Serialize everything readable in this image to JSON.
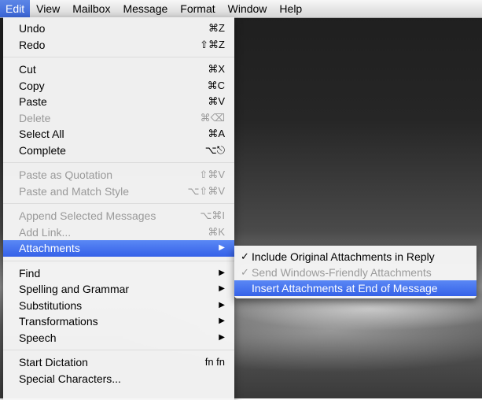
{
  "menubar": {
    "items": [
      "Edit",
      "View",
      "Mailbox",
      "Message",
      "Format",
      "Window",
      "Help"
    ]
  },
  "edit_menu": {
    "undo": {
      "label": "Undo",
      "shortcut": "⌘Z"
    },
    "redo": {
      "label": "Redo",
      "shortcut": "⇧⌘Z"
    },
    "cut": {
      "label": "Cut",
      "shortcut": "⌘X"
    },
    "copy": {
      "label": "Copy",
      "shortcut": "⌘C"
    },
    "paste": {
      "label": "Paste",
      "shortcut": "⌘V"
    },
    "delete": {
      "label": "Delete",
      "shortcut": "⌘⌫"
    },
    "select_all": {
      "label": "Select All",
      "shortcut": "⌘A"
    },
    "complete": {
      "label": "Complete",
      "shortcut": "⌥⎋"
    },
    "paste_quotation": {
      "label": "Paste as Quotation",
      "shortcut": "⇧⌘V"
    },
    "paste_match_style": {
      "label": "Paste and Match Style",
      "shortcut": "⌥⇧⌘V"
    },
    "append_selected": {
      "label": "Append Selected Messages",
      "shortcut": "⌥⌘I"
    },
    "add_link": {
      "label": "Add Link...",
      "shortcut": "⌘K"
    },
    "attachments": {
      "label": "Attachments"
    },
    "find": {
      "label": "Find"
    },
    "spelling": {
      "label": "Spelling and Grammar"
    },
    "substitutions": {
      "label": "Substitutions"
    },
    "transformations": {
      "label": "Transformations"
    },
    "speech": {
      "label": "Speech"
    },
    "start_dictation": {
      "label": "Start Dictation",
      "shortcut": "fn fn"
    },
    "special_characters": {
      "label": "Special Characters..."
    }
  },
  "attachments_submenu": {
    "include_original": {
      "label": "Include Original Attachments in Reply",
      "checked": true
    },
    "windows_friendly": {
      "label": "Send Windows-Friendly Attachments",
      "checked": true
    },
    "insert_at_end": {
      "label": "Insert Attachments at End of Message"
    }
  },
  "glyphs": {
    "check": "✓",
    "submenu_arrow": "▶"
  },
  "colors": {
    "highlight": "#3b66d8",
    "disabled_text": "#9a9a9a"
  }
}
